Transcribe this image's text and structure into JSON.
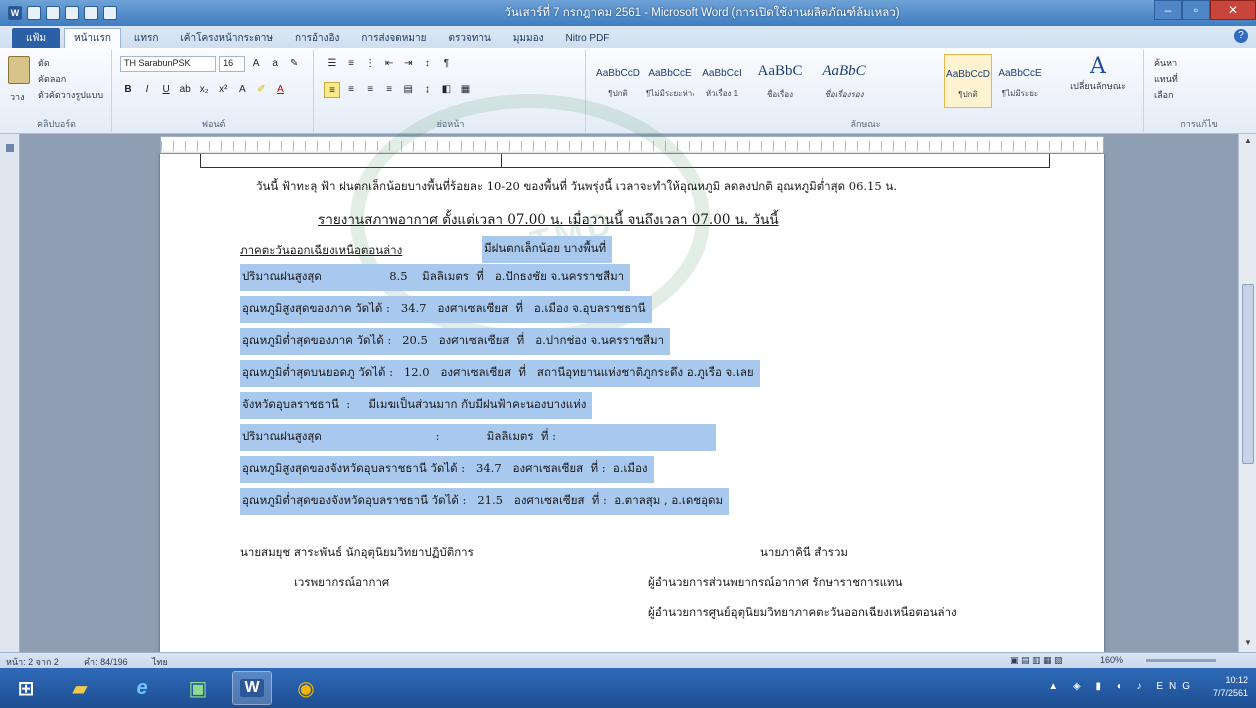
{
  "window": {
    "title": "วันเสาร์ที่ 7 กรกฎาคม 2561 - Microsoft Word (การเปิดใช้งานผลิตภัณฑ์ล้มเหลว)",
    "controls": {
      "minimize": "–",
      "maximize": "▫",
      "close": "✕"
    }
  },
  "ribbon_tabs": [
    "แฟ้ม",
    "หน้าแรก",
    "แทรก",
    "เค้าโครงหน้ากระดาษ",
    "การอ้างอิง",
    "การส่งจดหมาย",
    "ตรวจทาน",
    "มุมมอง",
    "Nitro PDF"
  ],
  "ribbon": {
    "clipboard": {
      "cut": "ตัด",
      "copy": "คัดลอก",
      "format_painter": "ตัวคัดวางรูปแบบ",
      "paste": "วาง",
      "label": "คลิปบอร์ด"
    },
    "font": {
      "name": "TH SarabunPSK",
      "size": "16",
      "label": "ฟอนต์"
    },
    "paragraph": {
      "label": "ย่อหน้า"
    },
    "styles": {
      "items": [
        {
          "preview": "AaBbCcD",
          "name": "¶ปกติ"
        },
        {
          "preview": "AaBbCcE",
          "name": "¶ไม่มีระยะห่าง"
        },
        {
          "preview": "AaBbCcI",
          "name": "หัวเรื่อง 1"
        },
        {
          "preview": "AaBbC",
          "name": "ชื่อเรื่อง"
        },
        {
          "preview": "AaBbC",
          "name": "ชื่อเรื่องรอง"
        },
        {
          "preview": "AaBbCcD",
          "name": "¶ปกติ"
        },
        {
          "preview": "AaBbCcE",
          "name": "¶ไม่มีระยะ"
        }
      ],
      "change_styles": "เปลี่ยนลักษณะ",
      "label": "ลักษณะ"
    },
    "editing": {
      "find": "ค้นหา",
      "replace": "แทนที่",
      "select": "เลือก",
      "label": "การแก้ไข"
    }
  },
  "document": {
    "line1": "วันนี้ ฟ้าทะลุ ฟ้า  ฝนตกเล็กน้อยบางพื้นที่ร้อยละ 10-20 ของพื้นที่ วันพรุ่งนี้ เวลาจะทำให้อุณหภูมิ ลดลงปกติ อุณหภูมิต่ำสุด 06.15 น.",
    "line2": "รายงานสภาพอากาศ ตั้งแต่เวลา  07.00  น.  เมื่อวานนี้   จนถึงเวลา  07.00  น.  วันนี้",
    "heading": "ภาคตะวันออกเฉียงเหนือตอนล่าง",
    "sky": "มีฝนตกเล็กน้อย บางพื้นที่",
    "rows": [
      {
        "label": "ปริมาณฝนสูงสุด",
        "value": "8.5",
        "unit": "มิลลิเมตร",
        "place": "อ.ปักธงชัย จ.นครราชสีมา"
      },
      {
        "label": "อุณหภูมิสูงสุดของภาค  วัดได้",
        "value": "34.7",
        "unit": "องศาเซลเซียส",
        "place": "อ.เมือง จ.อุบลราชธานี"
      },
      {
        "label": "อุณหภูมิต่ำสุดของภาค  วัดได้",
        "value": "20.5",
        "unit": "องศาเซลเซียส",
        "place": "อ.ปากช่อง จ.นครราชสีมา"
      },
      {
        "label": "อุณหภูมิต่ำสุดบนยอดภู  วัดได้",
        "value": "12.0",
        "unit": "องศาเซลเซียส",
        "place": "สถานีอุทยานแห่งชาติภูกระดึง อ.ภูเรือ จ.เลย"
      }
    ],
    "province_heading": "จังหวัดอุบลราชธานี",
    "province_sky": "มีเมฆเป็นส่วนมาก กับมีฝนฟ้าคะนองบางแห่ง",
    "province_rain": {
      "label": "ปริมาณฝนสูงสุด",
      "unit": "มิลลิเมตร"
    },
    "province_rows": [
      {
        "label": "อุณหภูมิสูงสุดของจังหวัดอุบลราชธานี  วัดได้",
        "value": "34.7",
        "unit": "องศาเซลเซียส",
        "place": "อ.เมือง"
      },
      {
        "label": "อุณหภูมิต่ำสุดของจังหวัดอุบลราชธานี  วัดได้",
        "value": "21.5",
        "unit": "องศาเซลเซียส",
        "place": "อ.ตาลสุม , อ.เดชอุดม"
      }
    ],
    "sign_left_name": "นายสมยุช สาระพันธ์  นักอุตุนิยมวิทยาปฏิบัติการ",
    "sign_left_role": "เวรพยากรณ์อากาศ",
    "sign_right_name": "นายภาคินี  สำรวม",
    "sign_right_role1": "ผู้อำนวยการส่วนพยากรณ์อากาศ  รักษาราชการแทน",
    "sign_right_role2": "ผู้อำนวยการศูนย์อุตุนิยมวิทยาภาคตะวันออกเฉียงเหนือตอนล่าง"
  },
  "statusbar": {
    "page": "หน้า: 2 จาก 2",
    "words": "คำ: 84/196",
    "lang": "ไทย",
    "zoom": "160%"
  },
  "taskbar": {
    "time": "10:12",
    "date": "7/7/2561",
    "tray_icons": "▲ ◈ ▮ ◖ ♪ ENG"
  },
  "accent_colors": {
    "titlebar": "#3f7cc0",
    "selection": "#a8c8ee",
    "taskbar": "#1d4e92",
    "watermark": "#3c8c50"
  }
}
